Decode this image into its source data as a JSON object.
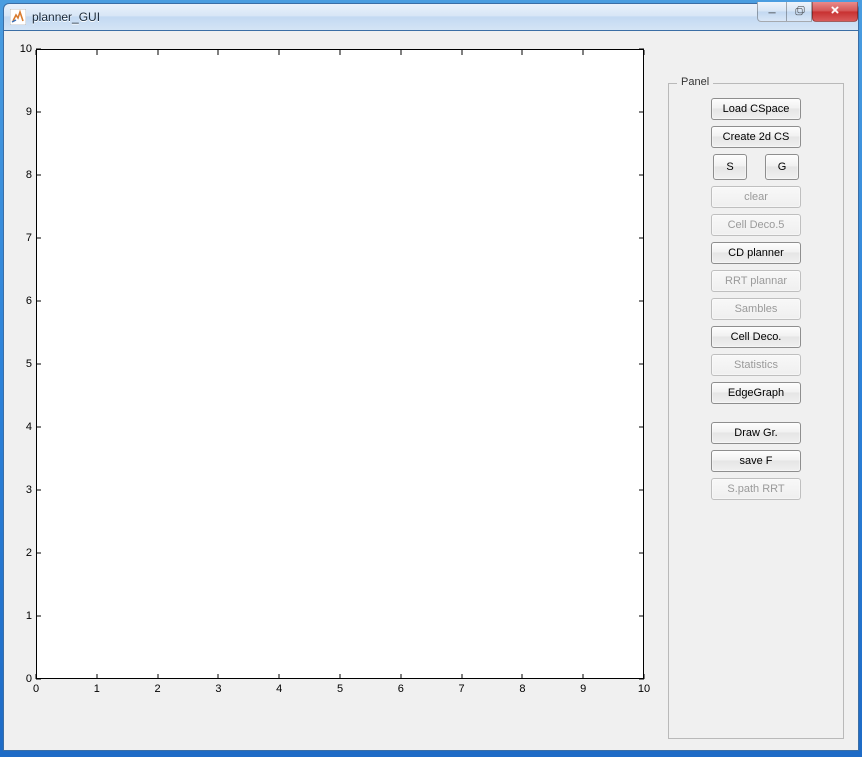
{
  "window": {
    "title": "planner_GUI"
  },
  "panel": {
    "title": "Panel",
    "buttons": {
      "load_cspace": "Load CSpace",
      "create_2d_cs": "Create 2d CS",
      "s": "S",
      "g": "G",
      "clear": "clear",
      "cell_deco_5": "Cell Deco.5",
      "cd_planner": "CD planner",
      "rrt_plannar": "RRT plannar",
      "sambles": "Sambles",
      "cell_deco": "Cell Deco.",
      "statistics": "Statistics",
      "edge_graph": "EdgeGraph",
      "draw_gr": "Draw Gr.",
      "save_f": "save F",
      "spath_rrt": "S.path RRT"
    }
  },
  "chart_data": {
    "type": "scatter",
    "x": [],
    "y": [],
    "xlim": [
      0,
      10
    ],
    "ylim": [
      0,
      10
    ],
    "xticks": [
      0,
      1,
      2,
      3,
      4,
      5,
      6,
      7,
      8,
      9,
      10
    ],
    "yticks": [
      0,
      1,
      2,
      3,
      4,
      5,
      6,
      7,
      8,
      9,
      10
    ],
    "title": "",
    "xlabel": "",
    "ylabel": ""
  }
}
